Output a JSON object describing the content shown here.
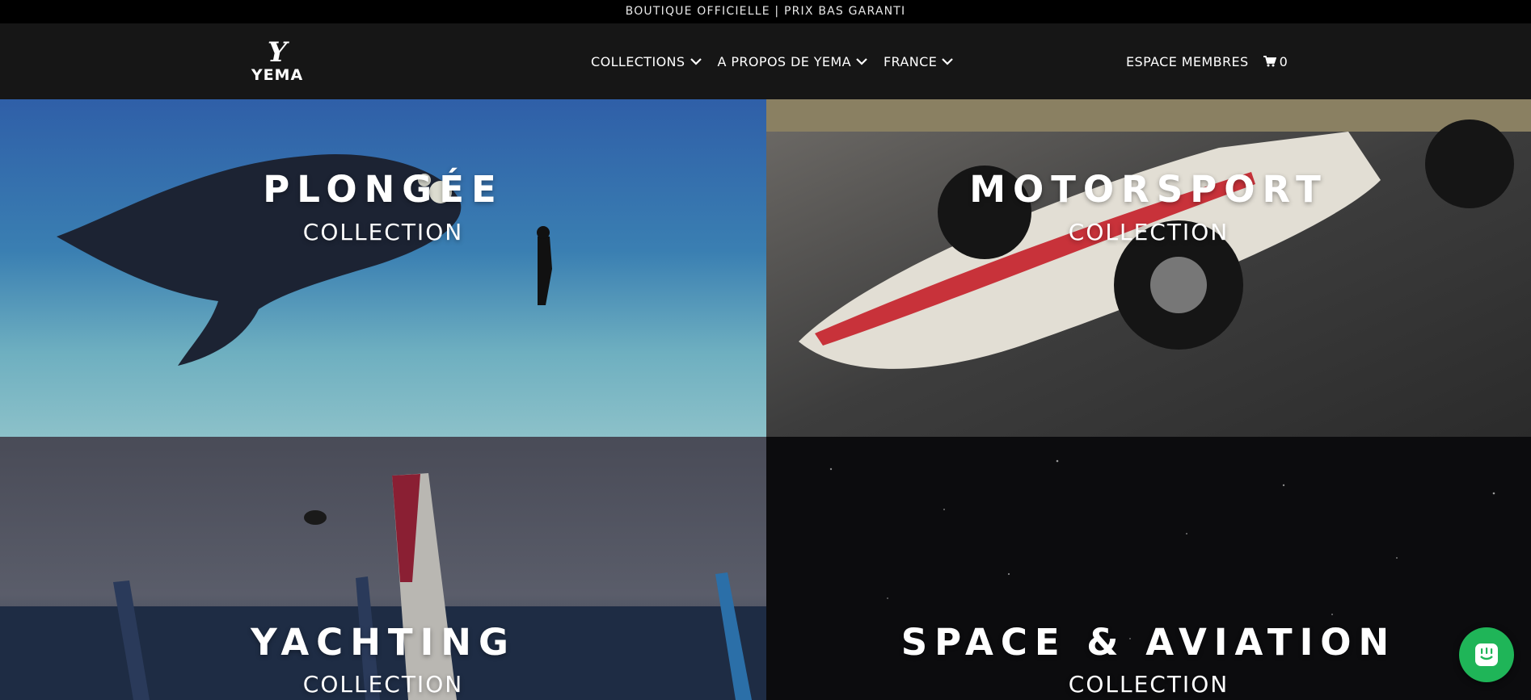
{
  "announcement": "BOUTIQUE OFFICIELLE | PRIX BAS GARANTI",
  "logo": {
    "mark": "Y",
    "wordmark": "YEMA"
  },
  "nav": {
    "items": [
      {
        "label": "COLLECTIONS",
        "icon": "chevron-down-icon"
      },
      {
        "label": "A PROPOS DE YEMA",
        "icon": "chevron-down-icon"
      },
      {
        "label": "FRANCE",
        "icon": "chevron-down-icon"
      }
    ],
    "members": "ESPACE MEMBRES",
    "cart_count": "0"
  },
  "collections": [
    {
      "title": "PLONGÉE",
      "subtitle": "COLLECTION"
    },
    {
      "title": "MOTORSPORT",
      "subtitle": "COLLECTION"
    },
    {
      "title": "YACHTING",
      "subtitle": "COLLECTION"
    },
    {
      "title": "SPACE & AVIATION",
      "subtitle": "COLLECTION"
    }
  ],
  "chat": {
    "icon": "chat-icon"
  },
  "colors": {
    "header": "#161616",
    "chat": "#1fb558"
  }
}
